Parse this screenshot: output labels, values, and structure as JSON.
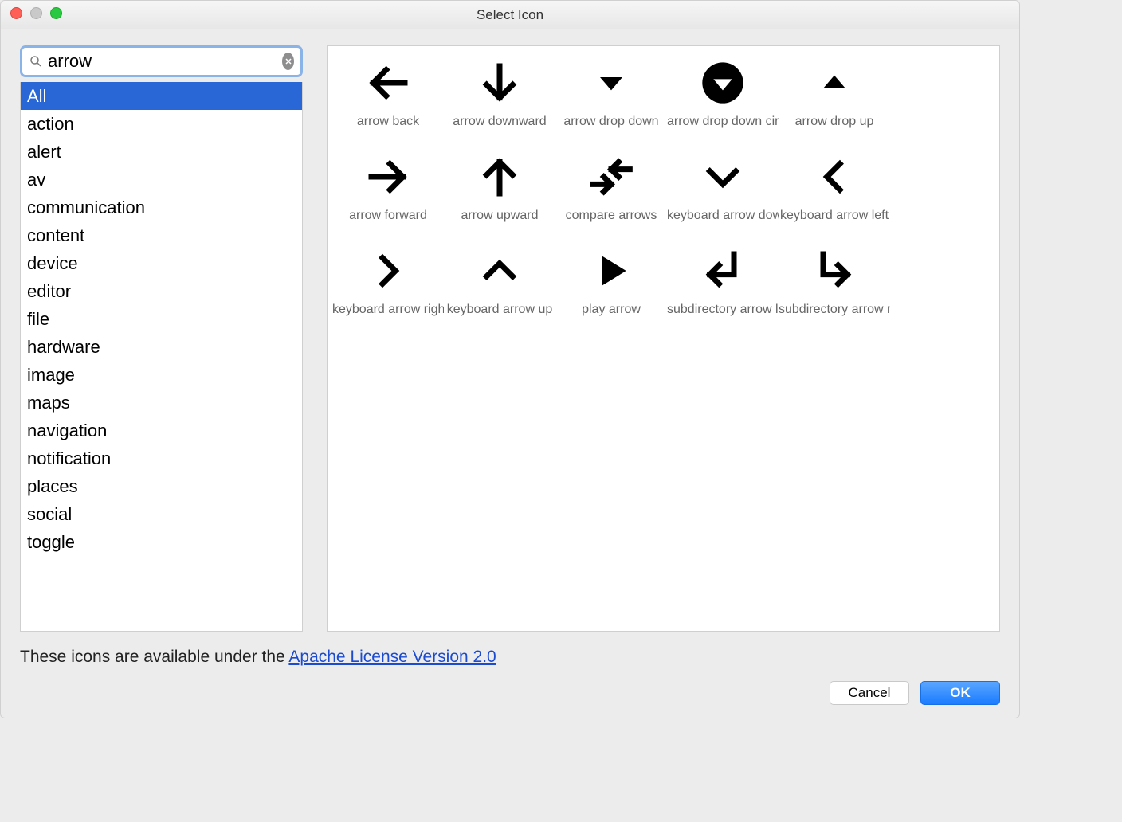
{
  "window": {
    "title": "Select Icon"
  },
  "search": {
    "value": "arrow"
  },
  "categories": [
    {
      "label": "All",
      "selected": true
    },
    {
      "label": "action",
      "selected": false
    },
    {
      "label": "alert",
      "selected": false
    },
    {
      "label": "av",
      "selected": false
    },
    {
      "label": "communication",
      "selected": false
    },
    {
      "label": "content",
      "selected": false
    },
    {
      "label": "device",
      "selected": false
    },
    {
      "label": "editor",
      "selected": false
    },
    {
      "label": "file",
      "selected": false
    },
    {
      "label": "hardware",
      "selected": false
    },
    {
      "label": "image",
      "selected": false
    },
    {
      "label": "maps",
      "selected": false
    },
    {
      "label": "navigation",
      "selected": false
    },
    {
      "label": "notification",
      "selected": false
    },
    {
      "label": "places",
      "selected": false
    },
    {
      "label": "social",
      "selected": false
    },
    {
      "label": "toggle",
      "selected": false
    }
  ],
  "icons": [
    {
      "name": "arrow back",
      "icon": "arrow-back"
    },
    {
      "name": "arrow downward",
      "icon": "arrow-downward"
    },
    {
      "name": "arrow drop down",
      "icon": "arrow-drop-down"
    },
    {
      "name": "arrow drop down circle",
      "icon": "arrow-drop-down-circle"
    },
    {
      "name": "arrow drop up",
      "icon": "arrow-drop-up"
    },
    {
      "name": "arrow forward",
      "icon": "arrow-forward"
    },
    {
      "name": "arrow upward",
      "icon": "arrow-upward"
    },
    {
      "name": "compare arrows",
      "icon": "compare-arrows"
    },
    {
      "name": "keyboard arrow down",
      "icon": "keyboard-arrow-down"
    },
    {
      "name": "keyboard arrow left",
      "icon": "keyboard-arrow-left"
    },
    {
      "name": "keyboard arrow right",
      "icon": "keyboard-arrow-right"
    },
    {
      "name": "keyboard arrow up",
      "icon": "keyboard-arrow-up"
    },
    {
      "name": "play arrow",
      "icon": "play-arrow"
    },
    {
      "name": "subdirectory arrow left",
      "icon": "subdirectory-arrow-left"
    },
    {
      "name": "subdirectory arrow right",
      "icon": "subdirectory-arrow-right"
    }
  ],
  "footer": {
    "license_prefix": "These icons are available under the ",
    "license_link": "Apache License Version 2.0",
    "cancel": "Cancel",
    "ok": "OK"
  }
}
